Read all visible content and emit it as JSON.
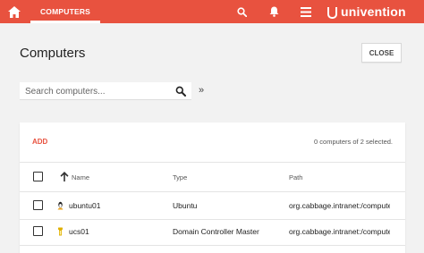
{
  "header": {
    "tab_label": "COMPUTERS",
    "brand": "univention",
    "icons": [
      "home-icon",
      "search-icon",
      "bell-icon",
      "menu-icon"
    ],
    "accent_color": "#e8523f"
  },
  "page": {
    "title": "Computers",
    "close_label": "CLOSE"
  },
  "search": {
    "placeholder": "Search computers...",
    "expand_label": "»"
  },
  "grid": {
    "add_label": "ADD",
    "selection_info": "0 computers of 2 selected.",
    "columns": [
      "Name",
      "Type",
      "Path"
    ],
    "rows": [
      {
        "name": "ubuntu01",
        "type": "Ubuntu",
        "path": "org.cabbage.intranet:/computers",
        "icon": "ubuntu-icon"
      },
      {
        "name": "ucs01",
        "type": "Domain Controller Master",
        "path": "org.cabbage.intranet:/computers",
        "icon": "ucs-icon"
      }
    ]
  }
}
